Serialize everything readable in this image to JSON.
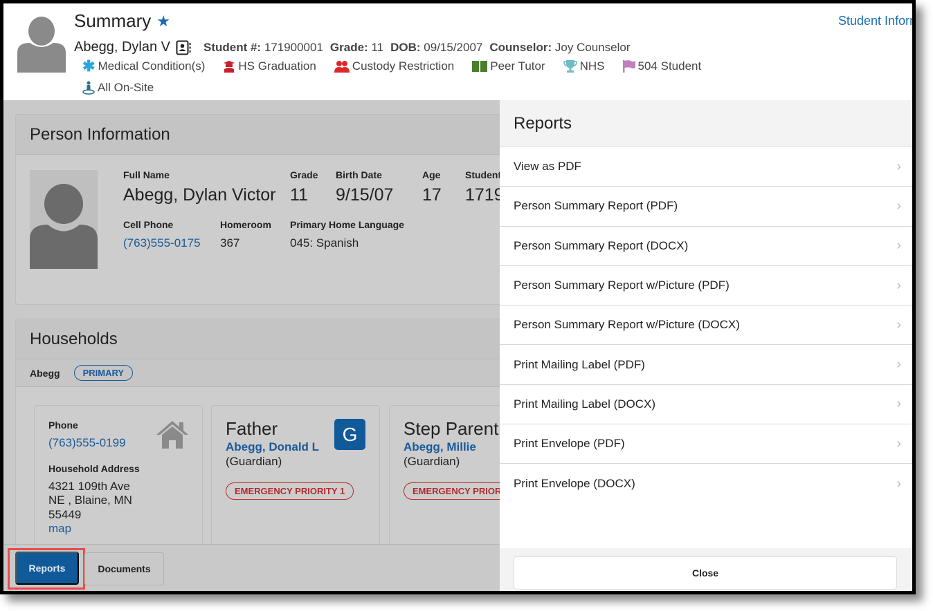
{
  "header": {
    "title": "Summary",
    "top_right_link": "Student Inform",
    "student_name": "Abegg, Dylan V",
    "meta": [
      {
        "label": "Student #:",
        "value": "171900001"
      },
      {
        "label": "Grade:",
        "value": "11"
      },
      {
        "label": "DOB:",
        "value": "09/15/2007"
      },
      {
        "label": "Counselor:",
        "value": "Joy Counselor"
      }
    ],
    "flags": [
      {
        "icon": "asterisk-icon",
        "label": "Medical Condition(s)",
        "color": "#29a6e0"
      },
      {
        "icon": "graduation-icon",
        "label": "HS Graduation",
        "color": "#c8202a"
      },
      {
        "icon": "users-icon",
        "label": "Custody Restriction",
        "color": "#e0262b"
      },
      {
        "icon": "book-icon",
        "label": "Peer Tutor",
        "color": "#4a7f2e"
      },
      {
        "icon": "trophy-icon",
        "label": "NHS",
        "color": "#6fbcc8"
      },
      {
        "icon": "flag-icon",
        "label": "504 Student",
        "color": "#c27fbd"
      }
    ],
    "flag_row2": {
      "icon": "person-location-icon",
      "label": "All On-Site",
      "color": "#2a6f8f"
    }
  },
  "person_info": {
    "title": "Person Information",
    "full_name_label": "Full Name",
    "full_name": "Abegg, Dylan Victor",
    "grade_label": "Grade",
    "grade": "11",
    "birth_date_label": "Birth Date",
    "birth_date": "9/15/07",
    "age_label": "Age",
    "age": "17",
    "student_label": "Student",
    "student_value": "1719",
    "cell_phone_label": "Cell Phone",
    "cell_phone": "(763)555-0175",
    "homeroom_label": "Homeroom",
    "homeroom": "367",
    "language_label": "Primary Home Language",
    "language": "045: Spanish"
  },
  "households": {
    "title": "Households",
    "household_name": "Abegg",
    "household_badge": "PRIMARY",
    "address_card": {
      "phone_label": "Phone",
      "phone": "(763)555-0199",
      "address_label": "Household Address",
      "address_lines": [
        "4321 109th Ave",
        "NE , Blaine, MN",
        "55449"
      ],
      "map_link": "map"
    },
    "members": [
      {
        "role": "Father",
        "name": "Abegg, Donald L",
        "relation": "(Guardian)",
        "priority": "EMERGENCY PRIORITY 1",
        "badge": "G"
      },
      {
        "role": "Step Parent",
        "name": "Abegg, Millie",
        "relation": "(Guardian)",
        "priority": "EMERGENCY PRIORI"
      }
    ]
  },
  "footer": {
    "reports_label": "Reports",
    "documents_label": "Documents"
  },
  "reports_drawer": {
    "title": "Reports",
    "items": [
      "View as PDF",
      "Person Summary Report (PDF)",
      "Person Summary Report (DOCX)",
      "Person Summary Report w/Picture (PDF)",
      "Person Summary Report w/Picture (DOCX)",
      "Print Mailing Label (PDF)",
      "Print Mailing Label (DOCX)",
      "Print Envelope (PDF)",
      "Print Envelope (DOCX)"
    ],
    "close_label": "Close"
  }
}
